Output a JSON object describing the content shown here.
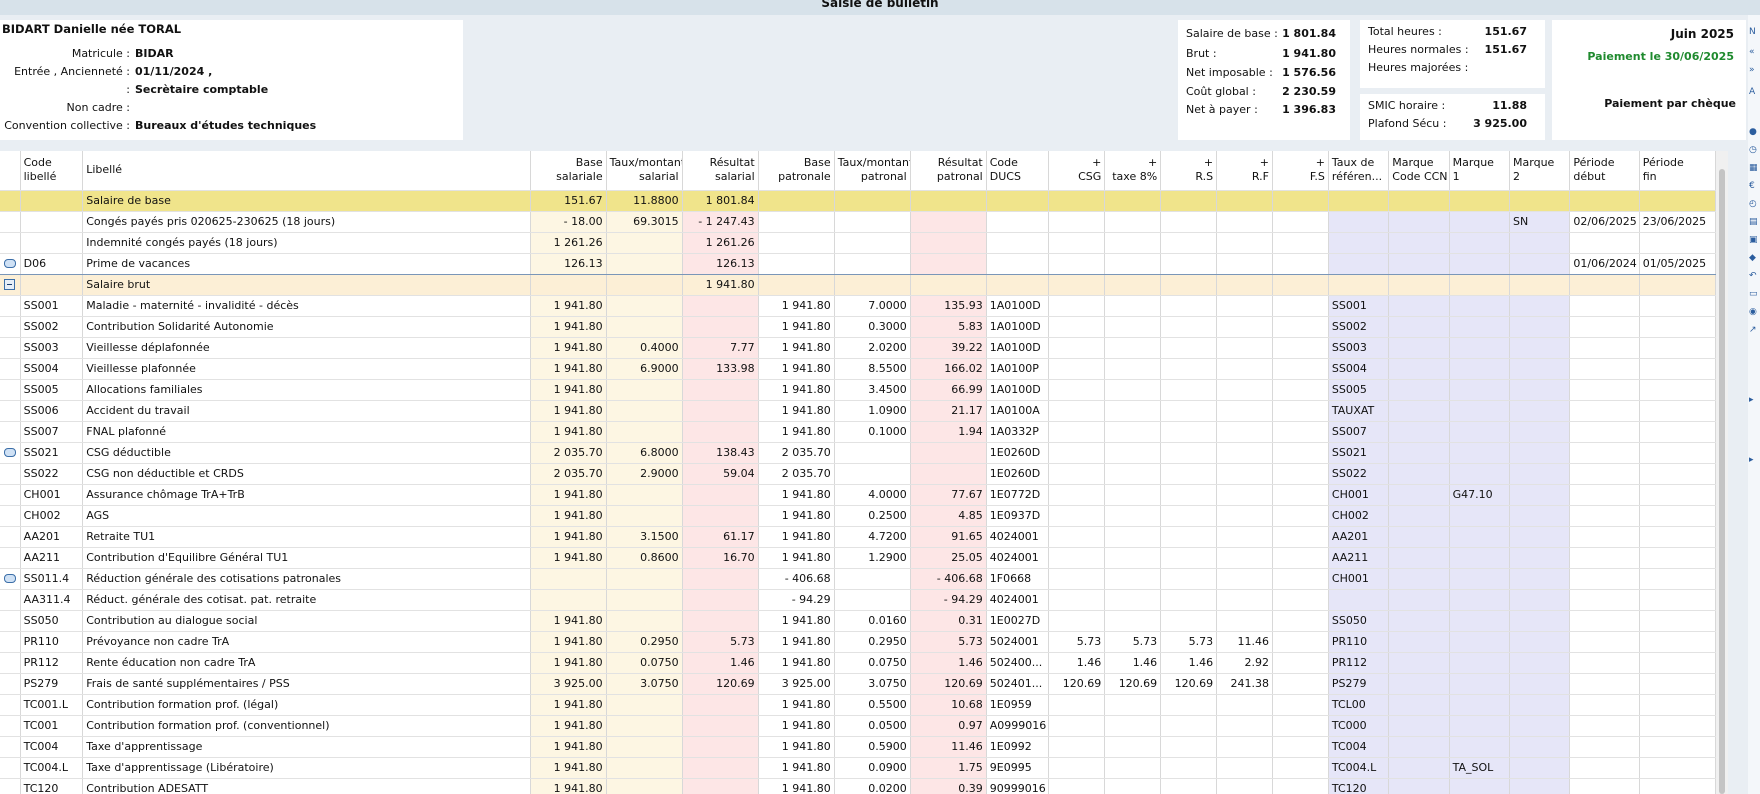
{
  "window_title": "Saisie de bulletin",
  "employee": {
    "name": "BIDART Danielle née TORAL",
    "fields": [
      {
        "label": "Matricule :",
        "value": "BIDAR"
      },
      {
        "label": "Entrée , Ancienneté :",
        "value": "01/11/2024 ,"
      },
      {
        "label": ":",
        "value": "Secrètaire comptable"
      },
      {
        "label": "Non cadre :",
        "value": ""
      },
      {
        "label": "Convention collective :",
        "value": "Bureaux d'études techniques"
      }
    ]
  },
  "salary_summary": [
    {
      "label": "Salaire de base :",
      "value": "1 801.84"
    },
    {
      "label": "Brut :",
      "value": "1 941.80"
    },
    {
      "label": "Net imposable :",
      "value": "1 576.56"
    },
    {
      "label": "Coût global :",
      "value": "2 230.59"
    },
    {
      "label": "Net à payer :",
      "value": "1 396.83"
    }
  ],
  "hours": [
    {
      "label": "Total heures :",
      "value": "151.67"
    },
    {
      "label": "Heures normales :",
      "value": "151.67"
    },
    {
      "label": "Heures majorées :",
      "value": ""
    }
  ],
  "smic": [
    {
      "label": "SMIC horaire :",
      "value": "11.88"
    },
    {
      "label": "Plafond Sécu :",
      "value": "3 925.00"
    }
  ],
  "payment": {
    "month": "Juin 2025",
    "date": "Paiement le 30/06/2025",
    "method": "Paiement par chèque",
    "accent_color": "#1f8a2e"
  },
  "columns": [
    {
      "l1": "Code",
      "l2": "libellé",
      "align": "l"
    },
    {
      "l1": "Libellé",
      "l2": "",
      "align": "l"
    },
    {
      "l1": "Base",
      "l2": "salariale",
      "align": "r"
    },
    {
      "l1": "Taux/montant",
      "l2": "salarial",
      "align": "r"
    },
    {
      "l1": "Résultat",
      "l2": "salarial",
      "align": "r"
    },
    {
      "l1": "Base",
      "l2": "patronale",
      "align": "r"
    },
    {
      "l1": "Taux/montant",
      "l2": "patronal",
      "align": "r"
    },
    {
      "l1": "Résultat",
      "l2": "patronal",
      "align": "r"
    },
    {
      "l1": "Code",
      "l2": "DUCS",
      "align": "l"
    },
    {
      "l1": "+",
      "l2": "CSG",
      "align": "r"
    },
    {
      "l1": "+",
      "l2": "taxe 8%",
      "align": "r"
    },
    {
      "l1": "+",
      "l2": "R.S",
      "align": "r"
    },
    {
      "l1": "+",
      "l2": "R.F",
      "align": "r"
    },
    {
      "l1": "+",
      "l2": "F.S",
      "align": "r"
    },
    {
      "l1": "Taux de",
      "l2": "référen...",
      "align": "l"
    },
    {
      "l1": "Marque",
      "l2": "Code CCN",
      "align": "l"
    },
    {
      "l1": "Marque",
      "l2": "1",
      "align": "l"
    },
    {
      "l1": "Marque",
      "l2": "2",
      "align": "l"
    },
    {
      "l1": "Période",
      "l2": "début",
      "align": "l"
    },
    {
      "l1": "Période",
      "l2": "fin",
      "align": "l"
    }
  ],
  "rows": [
    {
      "type": "yellow",
      "icon": "",
      "cells": [
        "",
        "Salaire de base",
        "151.67",
        "11.8800",
        "1 801.84",
        "",
        "",
        "",
        "",
        "",
        "",
        "",
        "",
        "",
        "",
        "",
        "",
        "",
        "",
        ""
      ]
    },
    {
      "type": "",
      "icon": "",
      "cells": [
        "",
        "Congés payés pris 020625-230625 (18 jours)",
        "- 18.00",
        "69.3015",
        "- 1 247.43",
        "",
        "",
        "",
        "",
        "",
        "",
        "",
        "",
        "",
        "",
        "",
        "",
        "SN",
        "02/06/2025",
        "23/06/2025"
      ]
    },
    {
      "type": "",
      "icon": "",
      "cells": [
        "",
        "Indemnité congés payés (18 jours)",
        "1 261.26",
        "",
        "1 261.26",
        "",
        "",
        "",
        "",
        "",
        "",
        "",
        "",
        "",
        "",
        "",
        "",
        "",
        "",
        ""
      ]
    },
    {
      "type": "sel",
      "icon": "comment",
      "cells": [
        "D06",
        "Prime de vacances",
        "126.13",
        "",
        "126.13",
        "",
        "",
        "",
        "",
        "",
        "",
        "",
        "",
        "",
        "",
        "",
        "",
        "",
        "01/06/2024",
        "01/05/2025"
      ]
    },
    {
      "type": "orange",
      "icon": "minus",
      "cells": [
        "",
        "Salaire brut",
        "",
        "",
        "1 941.80",
        "",
        "",
        "",
        "",
        "",
        "",
        "",
        "",
        "",
        "",
        "",
        "",
        "",
        "",
        ""
      ]
    },
    {
      "type": "",
      "icon": "",
      "cells": [
        "SS001",
        "Maladie - maternité - invalidité - décès",
        "1 941.80",
        "",
        "",
        "1 941.80",
        "7.0000",
        "135.93",
        "1A0100D",
        "",
        "",
        "",
        "",
        "",
        "SS001",
        "",
        "",
        "",
        "",
        ""
      ]
    },
    {
      "type": "",
      "icon": "",
      "cells": [
        "SS002",
        "Contribution Solidarité Autonomie",
        "1 941.80",
        "",
        "",
        "1 941.80",
        "0.3000",
        "5.83",
        "1A0100D",
        "",
        "",
        "",
        "",
        "",
        "SS002",
        "",
        "",
        "",
        "",
        ""
      ]
    },
    {
      "type": "",
      "icon": "",
      "cells": [
        "SS003",
        "Vieillesse déplafonnée",
        "1 941.80",
        "0.4000",
        "7.77",
        "1 941.80",
        "2.0200",
        "39.22",
        "1A0100D",
        "",
        "",
        "",
        "",
        "",
        "SS003",
        "",
        "",
        "",
        "",
        ""
      ]
    },
    {
      "type": "",
      "icon": "",
      "cells": [
        "SS004",
        "Vieillesse plafonnée",
        "1 941.80",
        "6.9000",
        "133.98",
        "1 941.80",
        "8.5500",
        "166.02",
        "1A0100P",
        "",
        "",
        "",
        "",
        "",
        "SS004",
        "",
        "",
        "",
        "",
        ""
      ]
    },
    {
      "type": "",
      "icon": "",
      "cells": [
        "SS005",
        "Allocations familiales",
        "1 941.80",
        "",
        "",
        "1 941.80",
        "3.4500",
        "66.99",
        "1A0100D",
        "",
        "",
        "",
        "",
        "",
        "SS005",
        "",
        "",
        "",
        "",
        ""
      ]
    },
    {
      "type": "",
      "icon": "",
      "cells": [
        "SS006",
        "Accident du travail",
        "1 941.80",
        "",
        "",
        "1 941.80",
        "1.0900",
        "21.17",
        "1A0100A",
        "",
        "",
        "",
        "",
        "",
        "TAUXAT",
        "",
        "",
        "",
        "",
        ""
      ]
    },
    {
      "type": "",
      "icon": "",
      "cells": [
        "SS007",
        "FNAL plafonné",
        "1 941.80",
        "",
        "",
        "1 941.80",
        "0.1000",
        "1.94",
        "1A0332P",
        "",
        "",
        "",
        "",
        "",
        "SS007",
        "",
        "",
        "",
        "",
        ""
      ]
    },
    {
      "type": "",
      "icon": "comment",
      "cells": [
        "SS021",
        "CSG déductible",
        "2 035.70",
        "6.8000",
        "138.43",
        "2 035.70",
        "",
        "",
        "1E0260D",
        "",
        "",
        "",
        "",
        "",
        "SS021",
        "",
        "",
        "",
        "",
        ""
      ]
    },
    {
      "type": "",
      "icon": "",
      "cells": [
        "SS022",
        "CSG non déductible et CRDS",
        "2 035.70",
        "2.9000",
        "59.04",
        "2 035.70",
        "",
        "",
        "1E0260D",
        "",
        "",
        "",
        "",
        "",
        "SS022",
        "",
        "",
        "",
        "",
        ""
      ]
    },
    {
      "type": "",
      "icon": "",
      "cells": [
        "CH001",
        "Assurance chômage TrA+TrB",
        "1 941.80",
        "",
        "",
        "1 941.80",
        "4.0000",
        "77.67",
        "1E0772D",
        "",
        "",
        "",
        "",
        "",
        "CH001",
        "",
        "G47.10",
        "",
        "",
        ""
      ]
    },
    {
      "type": "",
      "icon": "",
      "cells": [
        "CH002",
        "AGS",
        "1 941.80",
        "",
        "",
        "1 941.80",
        "0.2500",
        "4.85",
        "1E0937D",
        "",
        "",
        "",
        "",
        "",
        "CH002",
        "",
        "",
        "",
        "",
        ""
      ]
    },
    {
      "type": "",
      "icon": "",
      "cells": [
        "AA201",
        "Retraite TU1",
        "1 941.80",
        "3.1500",
        "61.17",
        "1 941.80",
        "4.7200",
        "91.65",
        "4024001",
        "",
        "",
        "",
        "",
        "",
        "AA201",
        "",
        "",
        "",
        "",
        ""
      ]
    },
    {
      "type": "",
      "icon": "",
      "cells": [
        "AA211",
        "Contribution d'Equilibre Général TU1",
        "1 941.80",
        "0.8600",
        "16.70",
        "1 941.80",
        "1.2900",
        "25.05",
        "4024001",
        "",
        "",
        "",
        "",
        "",
        "AA211",
        "",
        "",
        "",
        "",
        ""
      ]
    },
    {
      "type": "",
      "icon": "comment",
      "cells": [
        "SS011.4",
        "Réduction générale des cotisations patronales",
        "",
        "",
        "",
        "- 406.68",
        "",
        "- 406.68",
        "1F0668",
        "",
        "",
        "",
        "",
        "",
        "CH001",
        "",
        "",
        "",
        "",
        ""
      ]
    },
    {
      "type": "",
      "icon": "",
      "cells": [
        "AA311.4",
        "Réduct. générale des cotisat. pat. retraite",
        "",
        "",
        "",
        "- 94.29",
        "",
        "- 94.29",
        "4024001",
        "",
        "",
        "",
        "",
        "",
        "",
        "",
        "",
        "",
        "",
        ""
      ]
    },
    {
      "type": "",
      "icon": "",
      "cells": [
        "SS050",
        "Contribution au dialogue social",
        "1 941.80",
        "",
        "",
        "1 941.80",
        "0.0160",
        "0.31",
        "1E0027D",
        "",
        "",
        "",
        "",
        "",
        "SS050",
        "",
        "",
        "",
        "",
        ""
      ]
    },
    {
      "type": "",
      "icon": "",
      "cells": [
        "PR110",
        "Prévoyance non cadre TrA",
        "1 941.80",
        "0.2950",
        "5.73",
        "1 941.80",
        "0.2950",
        "5.73",
        "5024001",
        "5.73",
        "5.73",
        "5.73",
        "11.46",
        "",
        "PR110",
        "",
        "",
        "",
        "",
        ""
      ]
    },
    {
      "type": "",
      "icon": "",
      "cells": [
        "PR112",
        "Rente éducation non cadre TrA",
        "1 941.80",
        "0.0750",
        "1.46",
        "1 941.80",
        "0.0750",
        "1.46",
        "502400...",
        "1.46",
        "1.46",
        "1.46",
        "2.92",
        "",
        "PR112",
        "",
        "",
        "",
        "",
        ""
      ]
    },
    {
      "type": "",
      "icon": "",
      "cells": [
        "PS279",
        "Frais de santé supplémentaires / PSS",
        "3 925.00",
        "3.0750",
        "120.69",
        "3 925.00",
        "3.0750",
        "120.69",
        "502401...",
        "120.69",
        "120.69",
        "120.69",
        "241.38",
        "",
        "PS279",
        "",
        "",
        "",
        "",
        ""
      ]
    },
    {
      "type": "",
      "icon": "",
      "cells": [
        "TC001.L",
        "Contribution formation prof. (légal)",
        "1 941.80",
        "",
        "",
        "1 941.80",
        "0.5500",
        "10.68",
        "1E0959",
        "",
        "",
        "",
        "",
        "",
        "TCL00",
        "",
        "",
        "",
        "",
        ""
      ]
    },
    {
      "type": "",
      "icon": "",
      "cells": [
        "TC001",
        "Contribution formation prof. (conventionnel)",
        "1 941.80",
        "",
        "",
        "1 941.80",
        "0.0500",
        "0.97",
        "A0999016",
        "",
        "",
        "",
        "",
        "",
        "TC000",
        "",
        "",
        "",
        "",
        ""
      ]
    },
    {
      "type": "",
      "icon": "",
      "cells": [
        "TC004",
        "Taxe d'apprentissage",
        "1 941.80",
        "",
        "",
        "1 941.80",
        "0.5900",
        "11.46",
        "1E0992",
        "",
        "",
        "",
        "",
        "",
        "TC004",
        "",
        "",
        "",
        "",
        ""
      ]
    },
    {
      "type": "",
      "icon": "",
      "cells": [
        "TC004.L",
        "Taxe d'apprentissage (Libératoire)",
        "1 941.80",
        "",
        "",
        "1 941.80",
        "0.0900",
        "1.75",
        "9E0995",
        "",
        "",
        "",
        "",
        "",
        "TC004.L",
        "",
        "TA_SOL",
        "",
        "",
        ""
      ]
    },
    {
      "type": "",
      "icon": "",
      "cells": [
        "TC120",
        "Contribution ADESATT",
        "1 941.80",
        "",
        "",
        "1 941.80",
        "0.0200",
        "0.39",
        "90999016",
        "",
        "",
        "",
        "",
        "",
        "TC120",
        "",
        "",
        "",
        "",
        ""
      ]
    }
  ]
}
